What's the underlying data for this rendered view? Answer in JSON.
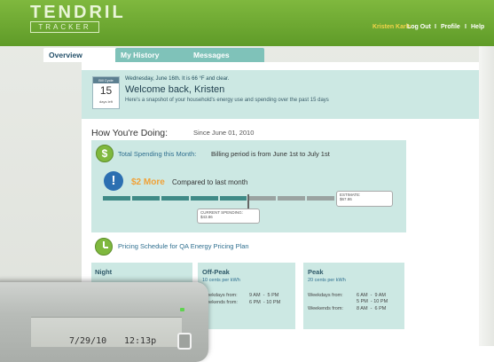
{
  "header": {
    "logo_main": "TENDRIL",
    "logo_sub": "TRACKER",
    "user_name": "Kristen Karls",
    "logout_label": "Log Out",
    "sep1": "I",
    "profile_label": "Profile",
    "sep2": "I",
    "help_label": "Help"
  },
  "tabs": [
    {
      "label": "Overview"
    },
    {
      "label": "My History"
    },
    {
      "label": "Messages"
    }
  ],
  "welcome": {
    "calendar_top": "Bill Cycle",
    "calendar_num": "15",
    "calendar_foot": "days left",
    "weather": "Wednesday, June 16th.   It is 66 °F and clear.",
    "title": "Welcome back, Kristen",
    "subtitle": "Here's a snapshot of your household's energy use and spending over the past 15 days"
  },
  "doing": {
    "title": "How You're Doing:",
    "since": "Since June 01, 2010"
  },
  "spending": {
    "icon": "dollar-icon",
    "title": "Total Spending this Month:",
    "period": "Billing period is from June 1st to July 1st",
    "warn_icon": "exclamation-icon",
    "more_amount": "$2 More",
    "compare": "Compared to last month",
    "estimate_label": "ESTIMATE:",
    "estimate_value": "$67.86",
    "current_label": "CURRENT SPENDING:",
    "current_value": "$43.86",
    "progress_fraction": 0.5
  },
  "pricing": {
    "icon": "clock-icon",
    "title": "Pricing Schedule for QA Energy Pricing Plan",
    "cards": [
      {
        "name": "Night",
        "rate": "",
        "lines": []
      },
      {
        "name": "Off-Peak",
        "rate": "10 cents per kWh",
        "lines": [
          {
            "label": "Weekdays from:",
            "value": "9 AM  -  5 PM"
          },
          {
            "label": "Weekends from:",
            "value": "6 PM  - 10 PM"
          }
        ]
      },
      {
        "name": "Peak",
        "rate": "20 cents per kWh",
        "lines": [
          {
            "label": "Weekdays from:",
            "value": "6 AM  -  9 AM"
          },
          {
            "label": "",
            "value": "5 PM  - 10 PM"
          },
          {
            "label": "Weekends from:",
            "value": "8 AM  -  6 PM"
          }
        ]
      }
    ]
  },
  "device": {
    "date": "7/29/10",
    "time": "12:13p"
  },
  "colors": {
    "header_green": "#6aa52f",
    "teal_box": "#cce8e3",
    "accent_orange": "#f1a137",
    "link_blue": "#2f6f8f"
  }
}
